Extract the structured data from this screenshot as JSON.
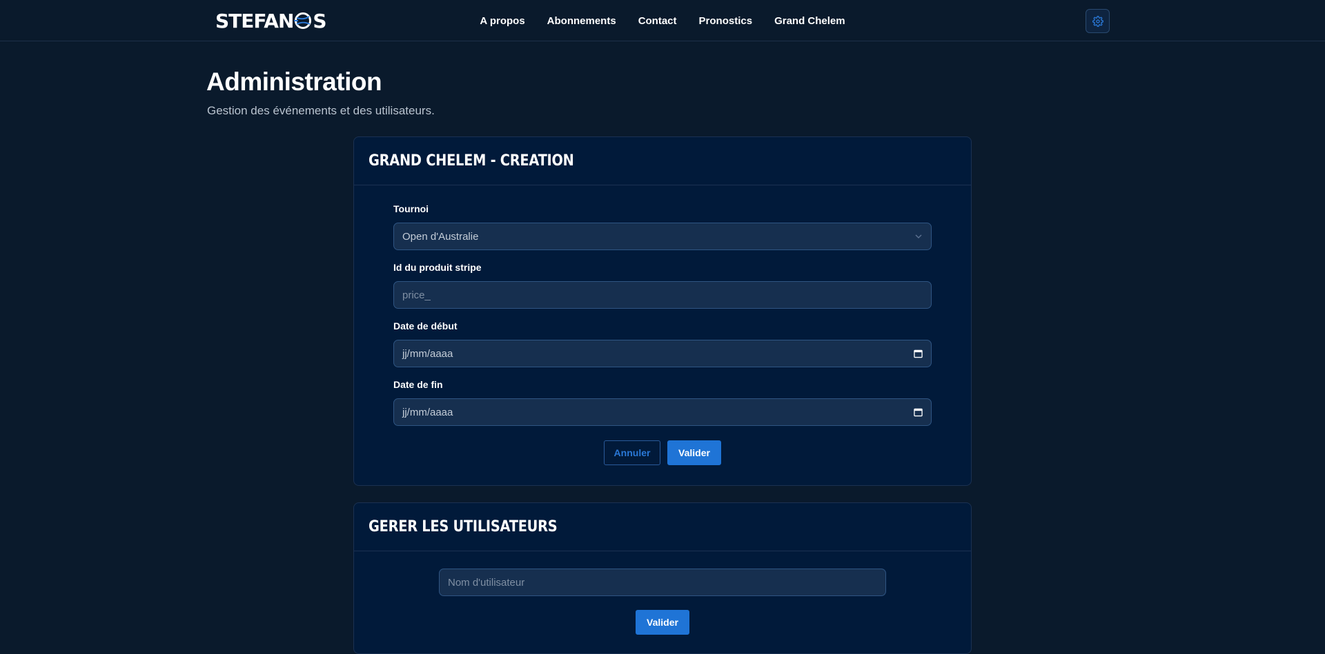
{
  "header": {
    "logo_text_left": "STEFAN",
    "logo_text_right": "S",
    "nav": [
      "A propos",
      "Abonnements",
      "Contact",
      "Pronostics",
      "Grand Chelem"
    ]
  },
  "page": {
    "title": "Administration",
    "subtitle": "Gestion des événements et des utilisateurs."
  },
  "grand_chelem_card": {
    "title": "GRAND CHELEM - CREATION",
    "tournoi_label": "Tournoi",
    "tournoi_value": "Open d'Australie",
    "stripe_label": "Id du produit stripe",
    "stripe_placeholder": "price_",
    "start_label": "Date de début",
    "start_value": "jj/mm/aaaa",
    "end_label": "Date de fin",
    "end_value": "jj/mm/aaaa",
    "cancel_label": "Annuler",
    "submit_label": "Valider"
  },
  "users_card": {
    "title": "GERER LES UTILISATEURS",
    "username_placeholder": "Nom d'utilisateur",
    "submit_label": "Valider"
  },
  "colors": {
    "background": "#0a1a2c",
    "card": "#011a3a",
    "accent": "#1f74d6"
  }
}
